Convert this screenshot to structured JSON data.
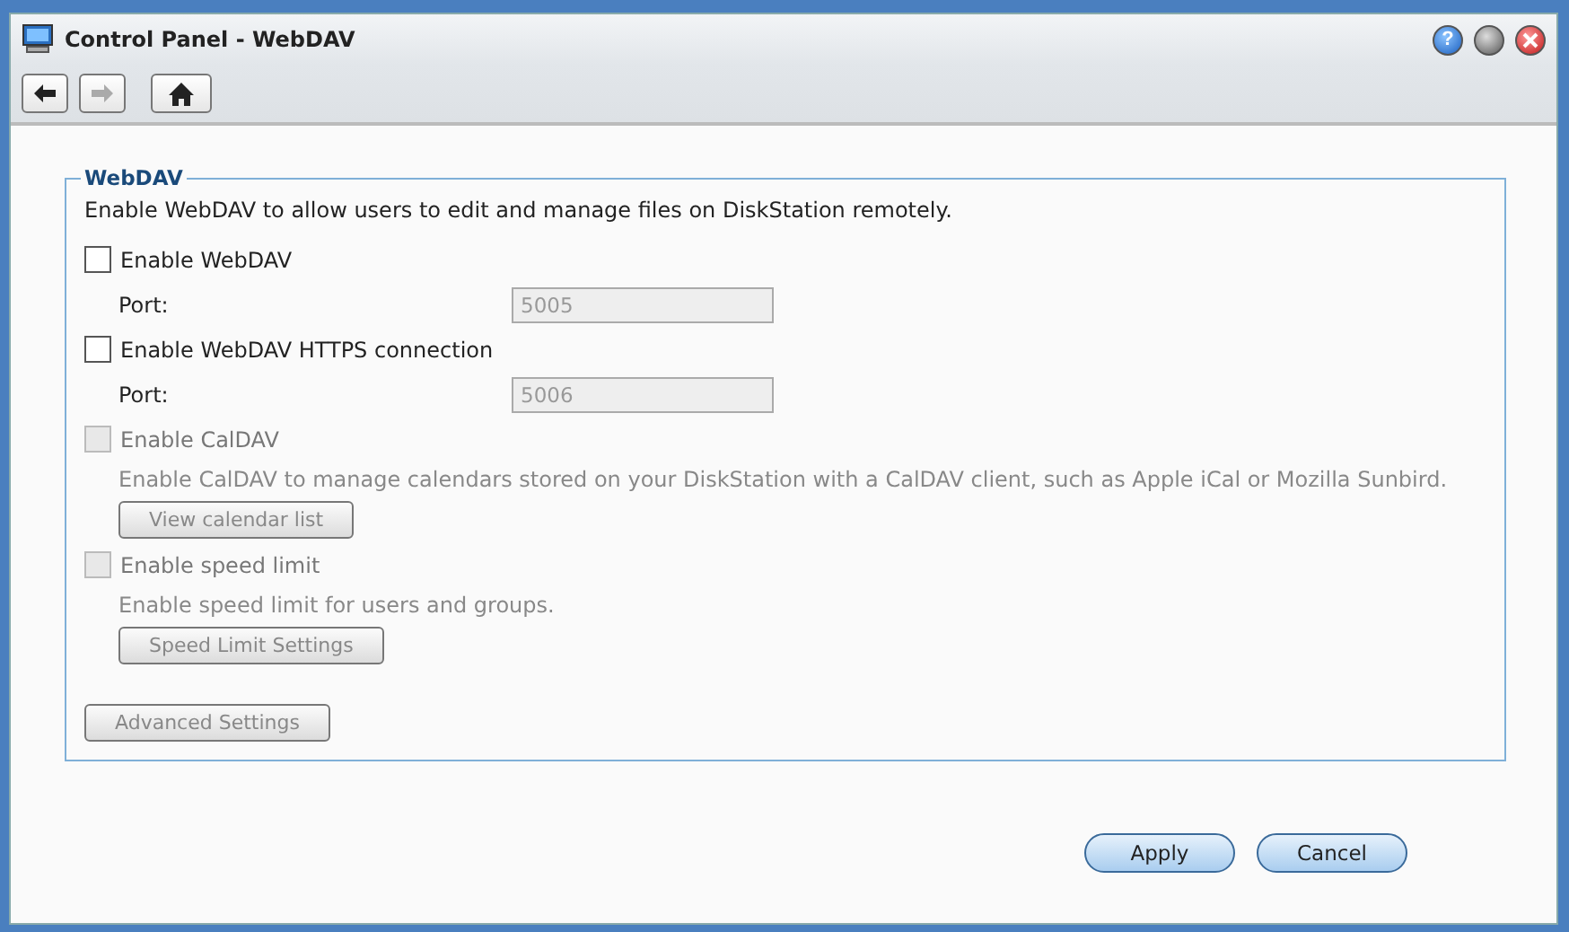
{
  "window": {
    "title": "Control Panel - WebDAV"
  },
  "window_controls": [
    {
      "kind": "help",
      "label": "?"
    },
    {
      "kind": "minimize"
    },
    {
      "kind": "close"
    }
  ],
  "toolbar": [
    {
      "kind": "back",
      "disabled": false
    },
    {
      "kind": "forward",
      "disabled": true
    },
    {
      "kind": "home",
      "disabled": false
    }
  ],
  "section": {
    "title": "WebDAV",
    "description": "Enable WebDAV to allow users to edit and manage files on DiskStation remotely.",
    "items": [
      {
        "kind": "checkbox",
        "label": "Enable WebDAV",
        "checked": false,
        "disabled": false
      },
      {
        "kind": "field",
        "label": "Port:",
        "value": "5005",
        "disabled": true
      },
      {
        "kind": "checkbox",
        "label": "Enable WebDAV HTTPS connection",
        "checked": false,
        "disabled": false
      },
      {
        "kind": "field",
        "label": "Port:",
        "value": "5006",
        "disabled": true
      },
      {
        "kind": "checkbox",
        "label": "Enable CalDAV",
        "checked": false,
        "disabled": true
      },
      {
        "kind": "note",
        "text": "Enable CalDAV to manage calendars stored on your DiskStation with a CalDAV client, such as Apple iCal or Mozilla Sunbird.",
        "disabled": true
      },
      {
        "kind": "button",
        "label": "View calendar list",
        "disabled": true
      },
      {
        "kind": "checkbox",
        "label": "Enable speed limit",
        "checked": false,
        "disabled": true
      },
      {
        "kind": "note",
        "text": "Enable speed limit for users and groups.",
        "disabled": true
      },
      {
        "kind": "button",
        "label": "Speed Limit Settings",
        "disabled": true
      },
      {
        "kind": "gap"
      },
      {
        "kind": "outer_button",
        "label": "Advanced Settings",
        "disabled": true
      }
    ]
  },
  "footer_buttons": [
    "Apply",
    "Cancel"
  ]
}
